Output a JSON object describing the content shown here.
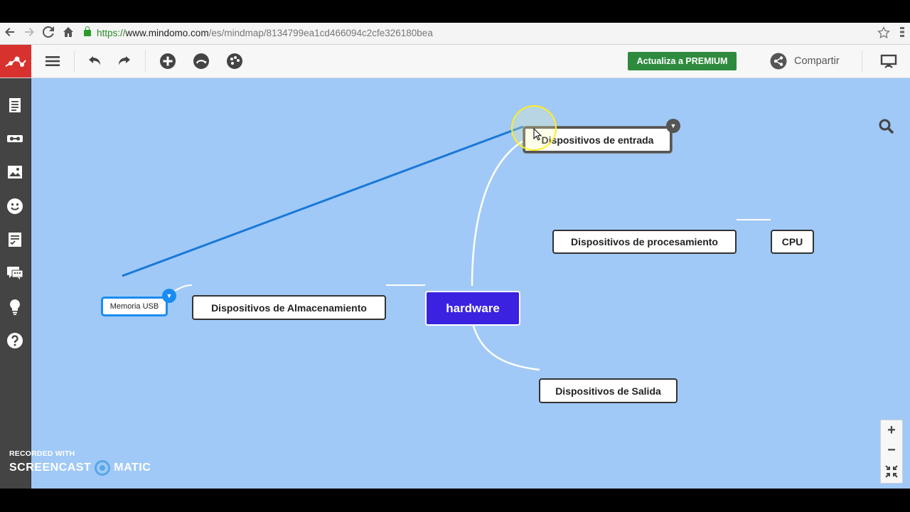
{
  "browser": {
    "url_protocol": "https://",
    "url_host": "www.mindomo.com",
    "url_path": "/es/mindmap/8134799ea1cd466094c2cfe326180bea"
  },
  "toolbar": {
    "premium_label": "Actualiza a PREMIUM",
    "share_label": "Compartir"
  },
  "mindmap": {
    "root": "hardware",
    "nodes": {
      "entrada": "Dispositivos de entrada",
      "procesamiento": "Dispositivos de procesamiento",
      "cpu": "CPU",
      "almacenamiento": "Dispositivos de Almacenamiento",
      "memoria_usb": "Memoria USB",
      "salida": "Dispositivos de Salida"
    }
  },
  "zoom": {
    "in": "+",
    "out": "−"
  },
  "watermark": {
    "line1": "RECORDED WITH",
    "line2a": "SCREENCAST",
    "line2b": "MATIC"
  },
  "colors": {
    "canvas": "#a0c9f7",
    "root_node": "#3b22e0",
    "premium": "#2e8b3e",
    "logo": "#d8322f",
    "relation_line": "#1a78d8"
  }
}
